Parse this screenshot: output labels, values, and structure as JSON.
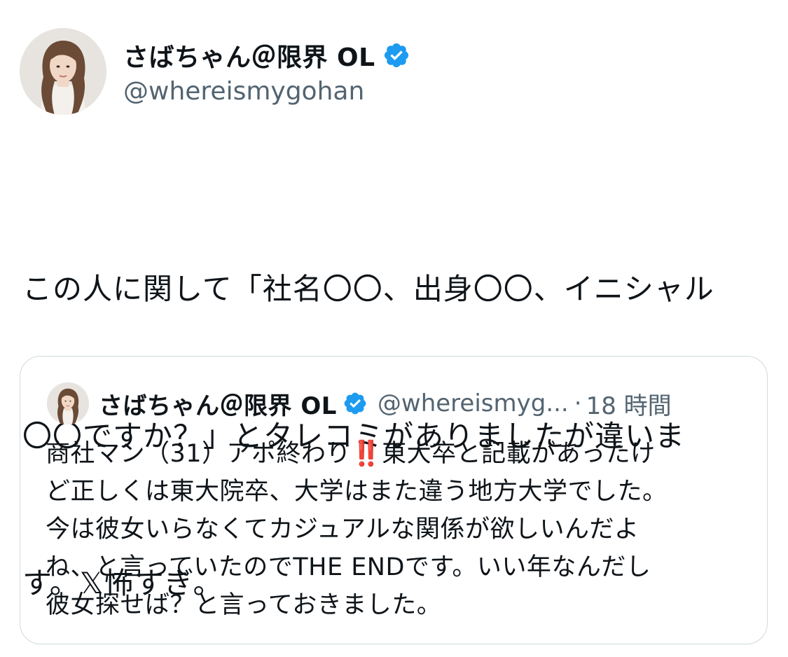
{
  "tweet": {
    "author": {
      "display_name": "さばちゃん＠限界 OL",
      "handle": "@whereismygohan",
      "verified_icon": "verified-badge-icon",
      "avatar_icon": "profile-photo"
    },
    "text_lines": [
      "この人に関して「社名〇〇、出身〇〇、イニシャル",
      "〇〇ですか？」とタレコミがありましたが違いま",
      "す。𝕏怖すぎ。"
    ]
  },
  "quote": {
    "author": {
      "display_name": "さばちゃん＠限界 OL",
      "handle": "@whereismyg...",
      "separator": "·",
      "time": "18 時間",
      "verified_icon": "verified-badge-icon"
    },
    "text_lines": [
      {
        "before": "商社マン（31）アポ終わり",
        "emoji": "‼️",
        "after": "東大卒と記載があったけ"
      },
      {
        "before": "ど正しくは東大院卒、大学はまた違う地方大学でした。",
        "emoji": "",
        "after": ""
      },
      {
        "before": "今は彼女いらなくてカジュアルな関係が欲しいんだよ",
        "emoji": "",
        "after": ""
      },
      {
        "before": "ね、と言っていたのでTHE ENDです。いい年なんだし",
        "emoji": "",
        "after": ""
      },
      {
        "before": "彼女探せば？と言っておきました。",
        "emoji": "",
        "after": ""
      }
    ]
  },
  "colors": {
    "verified_blue": "#1d9bf0",
    "text_primary": "#0f1419",
    "text_secondary": "#536471",
    "border": "#cfd9de"
  }
}
